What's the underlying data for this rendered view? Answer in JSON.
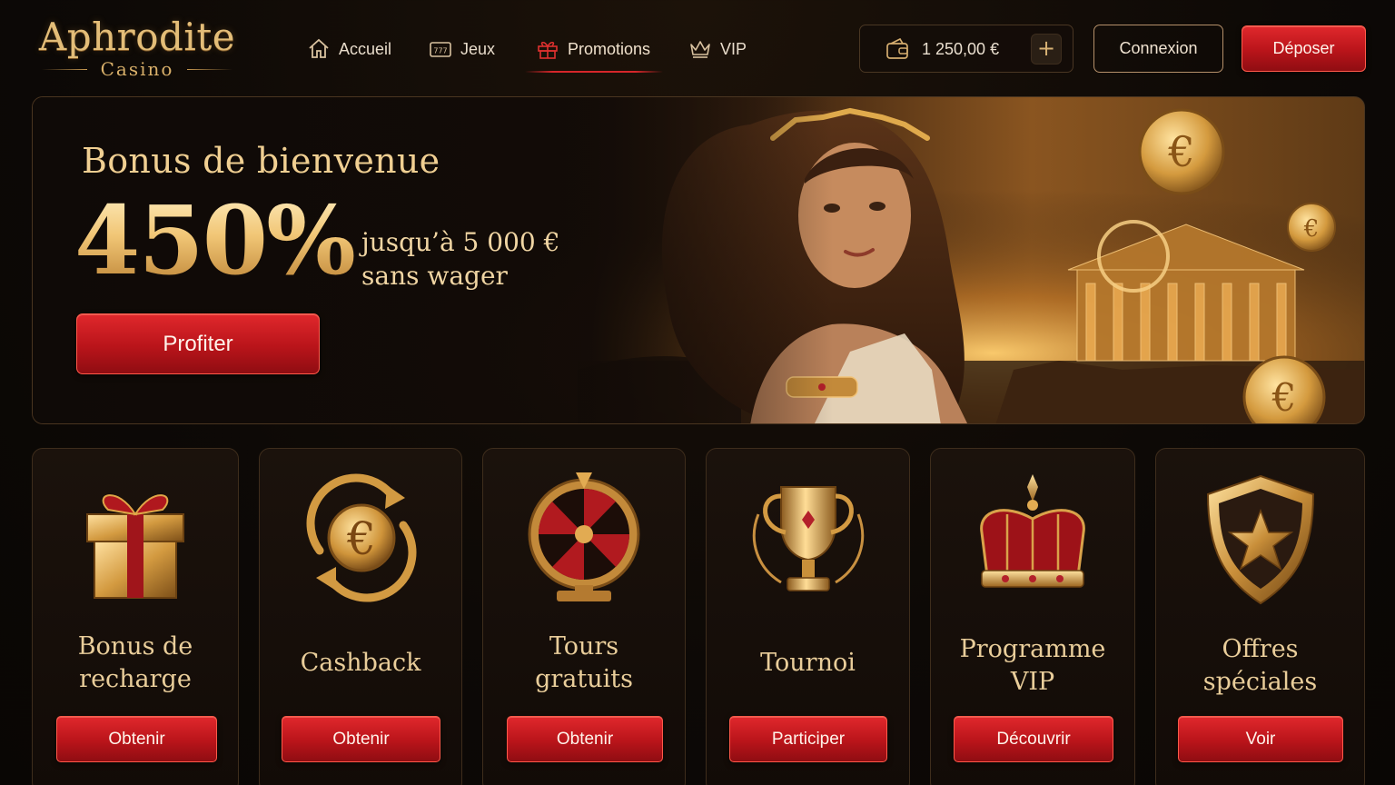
{
  "brand": {
    "name": "Aphrodite",
    "tagline": "Casino"
  },
  "nav": {
    "items": [
      {
        "label": "Accueil",
        "icon": "home-icon"
      },
      {
        "label": "Jeux",
        "icon": "slot-machine-icon"
      },
      {
        "label": "Promotions",
        "icon": "gift-icon",
        "active": true
      },
      {
        "label": "VIP",
        "icon": "crown-icon"
      }
    ]
  },
  "wallet": {
    "balance": "1 250,00 €",
    "add_label": "+"
  },
  "auth": {
    "login_label": "Connexion",
    "deposit_label": "Déposer"
  },
  "hero": {
    "title": "Bonus de bienvenue",
    "percent": "450%",
    "line1": "jusqu’à 5 000 €",
    "line2": "sans wager",
    "cta": "Profiter"
  },
  "promos": [
    {
      "title_line1": "Bonus de",
      "title_line2": "recharge",
      "button": "Obtenir",
      "icon": "gift-box-icon"
    },
    {
      "title_line1": "Cashback",
      "title_line2": "",
      "button": "Obtenir",
      "icon": "euro-cashback-icon"
    },
    {
      "title_line1": "Tours",
      "title_line2": "gratuits",
      "button": "Obtenir",
      "icon": "fortune-wheel-icon"
    },
    {
      "title_line1": "Tournoi",
      "title_line2": "",
      "button": "Participer",
      "icon": "trophy-icon"
    },
    {
      "title_line1": "Programme",
      "title_line2": "VIP",
      "button": "Découvrir",
      "icon": "crown-icon"
    },
    {
      "title_line1": "Offres",
      "title_line2": "spéciales",
      "button": "Voir",
      "icon": "star-shield-icon"
    }
  ],
  "colors": {
    "accent_red": "#c8181e",
    "gold": "#e3bd78",
    "background": "#0d0906"
  }
}
